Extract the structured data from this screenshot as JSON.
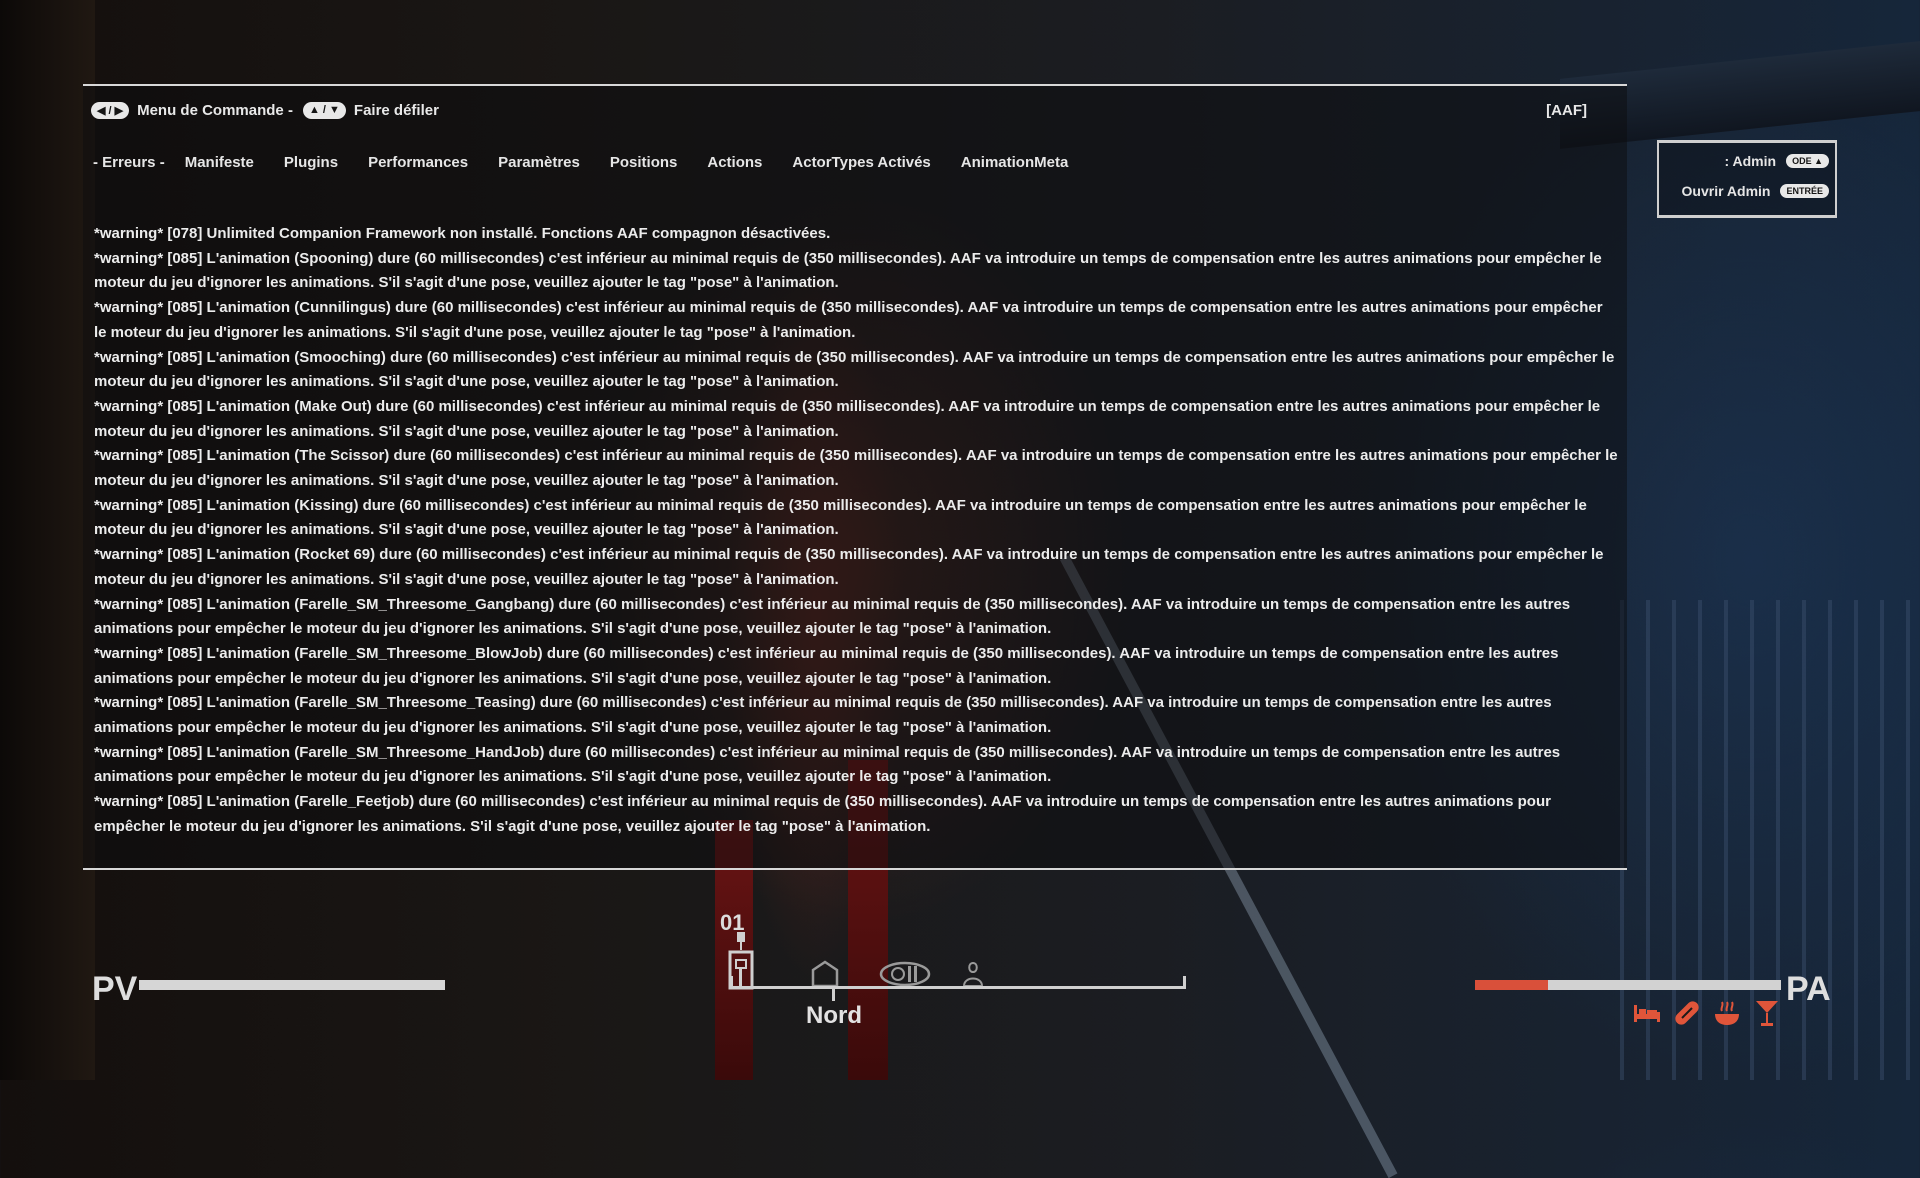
{
  "header": {
    "key_scroll_lr": "◀ / ▶",
    "menu_label": "Menu de Commande -",
    "key_scroll_ud": "▲ / ▼",
    "scroll_label": "Faire défiler",
    "app_tag": "[AAF]"
  },
  "tabs": [
    {
      "label": "- Erreurs -",
      "active": true
    },
    {
      "label": "Manifeste"
    },
    {
      "label": "Plugins"
    },
    {
      "label": "Performances"
    },
    {
      "label": "Paramètres"
    },
    {
      "label": "Positions"
    },
    {
      "label": "Actions"
    },
    {
      "label": "ActorTypes Activés"
    },
    {
      "label": "AnimationMeta"
    }
  ],
  "log_lines": [
    "*warning* [078] Unlimited Companion Framework non installé. Fonctions AAF compagnon désactivées.",
    "*warning* [085] L'animation (Spooning) dure (60 millisecondes) c'est inférieur au minimal requis de (350 millisecondes). AAF va introduire un temps de compensation entre les autres animations pour empêcher le moteur du jeu d'ignorer les animations. S'il s'agit d'une pose, veuillez ajouter le tag \"pose\" à l'animation.",
    "*warning* [085] L'animation (Cunnilingus) dure (60 millisecondes) c'est inférieur au minimal requis de (350 millisecondes). AAF va introduire un temps de compensation entre les autres animations pour empêcher le moteur du jeu d'ignorer les animations. S'il s'agit d'une pose, veuillez ajouter le tag \"pose\" à l'animation.",
    "*warning* [085] L'animation (Smooching) dure (60 millisecondes) c'est inférieur au minimal requis de (350 millisecondes). AAF va introduire un temps de compensation entre les autres animations pour empêcher le moteur du jeu d'ignorer les animations. S'il s'agit d'une pose, veuillez ajouter le tag \"pose\" à l'animation.",
    "*warning* [085] L'animation (Make Out) dure (60 millisecondes) c'est inférieur au minimal requis de (350 millisecondes). AAF va introduire un temps de compensation entre les autres animations pour empêcher le moteur du jeu d'ignorer les animations. S'il s'agit d'une pose, veuillez ajouter le tag \"pose\" à l'animation.",
    "*warning* [085] L'animation (The Scissor) dure (60 millisecondes) c'est inférieur au minimal requis de (350 millisecondes). AAF va introduire un temps de compensation entre les autres animations pour empêcher le moteur du jeu d'ignorer les animations. S'il s'agit d'une pose, veuillez ajouter le tag \"pose\" à l'animation.",
    "*warning* [085] L'animation (Kissing) dure (60 millisecondes) c'est inférieur au minimal requis de (350 millisecondes). AAF va introduire un temps de compensation entre les autres animations pour empêcher le moteur du jeu d'ignorer les animations. S'il s'agit d'une pose, veuillez ajouter le tag \"pose\" à l'animation.",
    "*warning* [085] L'animation (Rocket 69) dure (60 millisecondes) c'est inférieur au minimal requis de (350 millisecondes). AAF va introduire un temps de compensation entre les autres animations pour empêcher le moteur du jeu d'ignorer les animations. S'il s'agit d'une pose, veuillez ajouter le tag \"pose\" à l'animation.",
    "*warning* [085] L'animation (Farelle_SM_Threesome_Gangbang) dure (60 millisecondes) c'est inférieur au minimal requis de (350 millisecondes). AAF va introduire un temps de compensation entre les autres animations pour empêcher le moteur du jeu d'ignorer les animations. S'il s'agit d'une pose, veuillez ajouter le tag \"pose\" à l'animation.",
    "*warning* [085] L'animation (Farelle_SM_Threesome_BlowJob) dure (60 millisecondes) c'est inférieur au minimal requis de (350 millisecondes). AAF va introduire un temps de compensation entre les autres animations pour empêcher le moteur du jeu d'ignorer les animations. S'il s'agit d'une pose, veuillez ajouter le tag \"pose\" à l'animation.",
    "*warning* [085] L'animation (Farelle_SM_Threesome_Teasing) dure (60 millisecondes) c'est inférieur au minimal requis de (350 millisecondes). AAF va introduire un temps de compensation entre les autres animations pour empêcher le moteur du jeu d'ignorer les animations. S'il s'agit d'une pose, veuillez ajouter le tag \"pose\" à l'animation.",
    "*warning* [085] L'animation (Farelle_SM_Threesome_HandJob) dure (60 millisecondes) c'est inférieur au minimal requis de (350 millisecondes). AAF va introduire un temps de compensation entre les autres animations pour empêcher le moteur du jeu d'ignorer les animations. S'il s'agit d'une pose, veuillez ajouter le tag \"pose\" à l'animation.",
    "*warning* [085] L'animation (Farelle_Feetjob) dure (60 millisecondes) c'est inférieur au minimal requis de (350 millisecondes). AAF va introduire un temps de compensation entre les autres animations pour empêcher le moteur du jeu d'ignorer les animations. S'il s'agit d'une pose, veuillez ajouter le tag \"pose\" à l'animation."
  ],
  "admin": {
    "row1_label": ": Admin",
    "row1_key": "ODE ▲",
    "row2_label": "Ouvrir Admin",
    "row2_key": "ENTRÉE"
  },
  "hud": {
    "hp_label": "PV",
    "hp_fraction": 1.0,
    "ap_label": "PA",
    "ap_fraction": 0.24,
    "compass_number": "01",
    "compass_direction": "Nord",
    "need_icons": [
      "bed-icon",
      "pill-icon",
      "bowl-icon",
      "cocktail-icon"
    ],
    "accent_color": "#d9503a"
  }
}
